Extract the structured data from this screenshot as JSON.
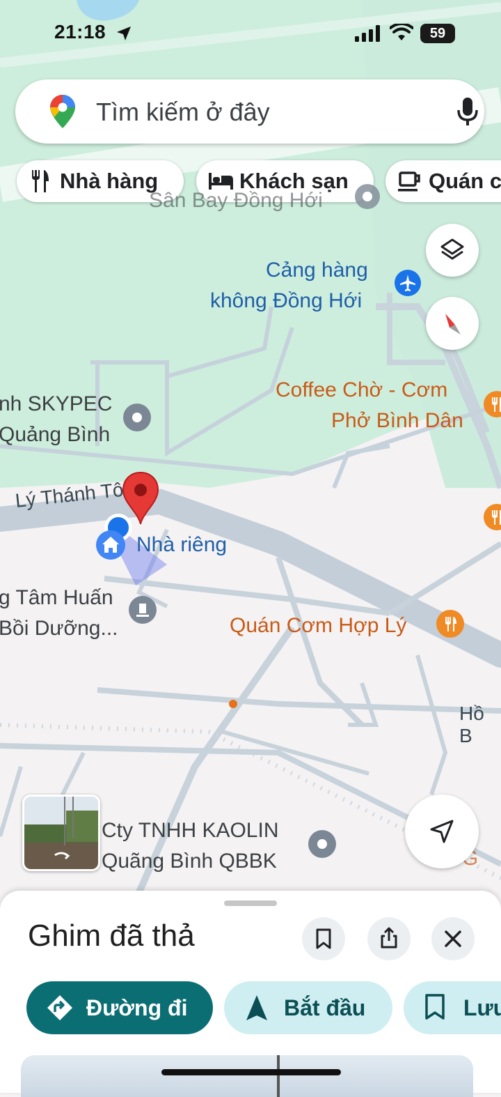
{
  "status_bar": {
    "time": "21:18",
    "battery": "59"
  },
  "search": {
    "placeholder": "Tìm kiếm ở đây"
  },
  "chips": [
    {
      "label": "Nhà hàng",
      "icon": "utensils-icon"
    },
    {
      "label": "Khách sạn",
      "icon": "bed-icon"
    },
    {
      "label": "Quán c",
      "icon": "coffee-icon"
    }
  ],
  "map": {
    "labels": {
      "airport_partial": "Sân Bay Đồng Hới",
      "airport_line1": "Cảng hàng",
      "airport_line2": "không Đồng Hới",
      "coffee_line1": "Coffee Chờ - Cơm",
      "coffee_line2": "Phở Bình Dân",
      "skypec_line1": "nh SKYPEC",
      "skypec_line2": "Quảng Bình",
      "street": "Lý Thánh Tông",
      "home": "Nhà riêng",
      "school_line1": "g Tâm Huấn",
      "school_line2": "Bồi Dưỡng...",
      "restaurant": "Quán Cơm Hợp Lý",
      "ho_street": "Hồ B",
      "company_line1": "Cty TNHH KAOLIN",
      "company_line2": "Quãng Bình QBBK",
      "partial_right": "L G"
    }
  },
  "sheet": {
    "title": "Ghim đã thả",
    "actions": {
      "directions": "Đường đi",
      "start": "Bắt đầu",
      "save": "Lưu"
    }
  },
  "colors": {
    "accent": "#0b6e73",
    "map_green": "#cdeedd",
    "map_road": "#c5d0da",
    "poi_blue": "#1a73e8",
    "poi_orange": "#e8711c",
    "pin_red": "#e53935"
  }
}
